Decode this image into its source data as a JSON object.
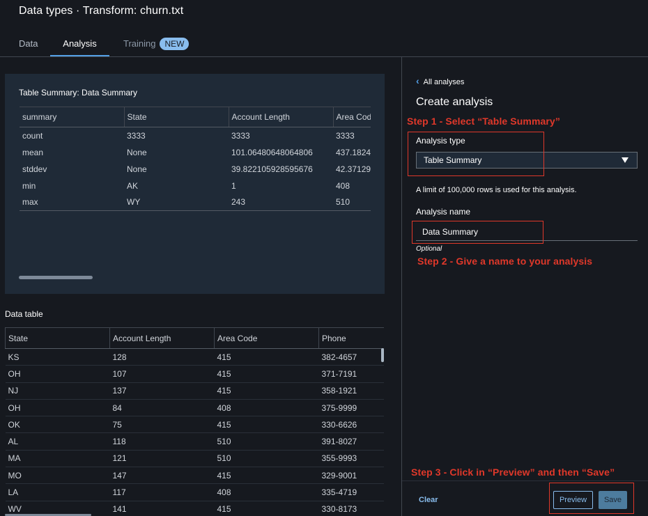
{
  "header": {
    "title": "Data types · Transform: churn.txt"
  },
  "tabs": {
    "data": "Data",
    "analysis": "Analysis",
    "training": "Training",
    "training_badge": "NEW"
  },
  "summary": {
    "title": "Table Summary: Data Summary",
    "columns": [
      "summary",
      "State",
      "Account Length",
      "Area Code"
    ],
    "rows": [
      [
        "count",
        "3333",
        "3333",
        "3333"
      ],
      [
        "mean",
        "None",
        "101.06480648064806",
        "437.1824"
      ],
      [
        "stddev",
        "None",
        "39.822105928595676",
        "42.37129"
      ],
      [
        "min",
        "AK",
        "1",
        "408"
      ],
      [
        "max",
        "WY",
        "243",
        "510"
      ]
    ]
  },
  "data_table": {
    "label": "Data table",
    "columns": [
      "State",
      "Account Length",
      "Area Code",
      "Phone"
    ],
    "rows": [
      [
        "KS",
        "128",
        "415",
        "382-4657"
      ],
      [
        "OH",
        "107",
        "415",
        "371-7191"
      ],
      [
        "NJ",
        "137",
        "415",
        "358-1921"
      ],
      [
        "OH",
        "84",
        "408",
        "375-9999"
      ],
      [
        "OK",
        "75",
        "415",
        "330-6626"
      ],
      [
        "AL",
        "118",
        "510",
        "391-8027"
      ],
      [
        "MA",
        "121",
        "510",
        "355-9993"
      ],
      [
        "MO",
        "147",
        "415",
        "329-9001"
      ],
      [
        "LA",
        "117",
        "408",
        "335-4719"
      ],
      [
        "WV",
        "141",
        "415",
        "330-8173"
      ]
    ]
  },
  "panel": {
    "back_link": "All analyses",
    "title": "Create analysis",
    "analysis_type_label": "Analysis type",
    "analysis_type_value": "Table Summary",
    "limit_note": "A limit of 100,000 rows is used for this analysis.",
    "analysis_name_label": "Analysis name",
    "analysis_name_value": "Data Summary",
    "optional": "Optional",
    "clear": "Clear",
    "preview": "Preview",
    "save": "Save"
  },
  "annotations": {
    "step1": "Step 1 - Select “Table Summary”",
    "step2": "Step 2 - Give a name to your analysis",
    "step3": "Step 3 - Click in “Preview” and then “Save”"
  },
  "colors": {
    "background": "#16191f",
    "accent_blue": "#539fe5",
    "annotation_red": "#e0382a"
  }
}
